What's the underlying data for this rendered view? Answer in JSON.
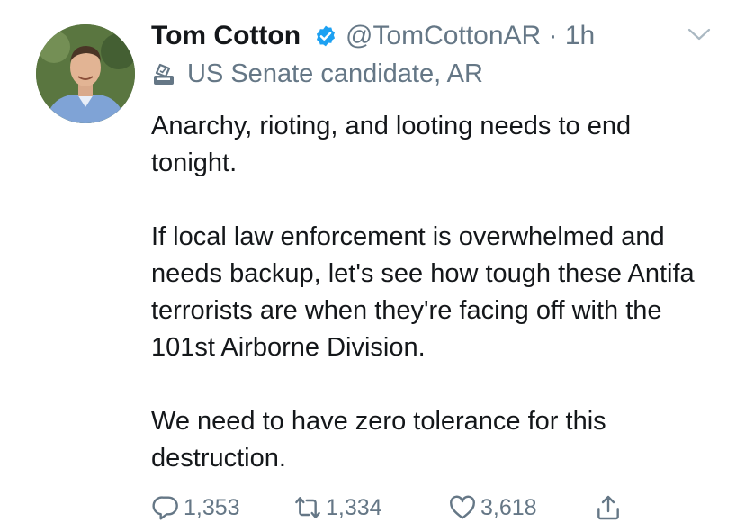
{
  "tweet": {
    "author_name": "Tom Cotton",
    "handle_time": "@TomCottonAR · 1h",
    "label": "US Senate candidate, AR",
    "paragraphs": [
      "Anarchy, rioting, and looting needs to end tonight.",
      "If local law enforcement is overwhelmed and needs backup, let's see how tough these Antifa terrorists are when they're facing off with the 101st Airborne Division.",
      "We need to have zero tolerance for this destruction."
    ],
    "replies": "1,353",
    "retweets": "1,334",
    "likes": "3,618"
  },
  "icons": {
    "verified": "verified-badge-icon",
    "chevron": "chevron-down-icon",
    "label": "ballot-box-icon",
    "reply": "reply-icon",
    "retweet": "retweet-icon",
    "like": "heart-icon",
    "share": "share-icon"
  },
  "colors": {
    "verified": "#1da1f2",
    "secondary_text": "#657786",
    "primary_text": "#14171a"
  }
}
